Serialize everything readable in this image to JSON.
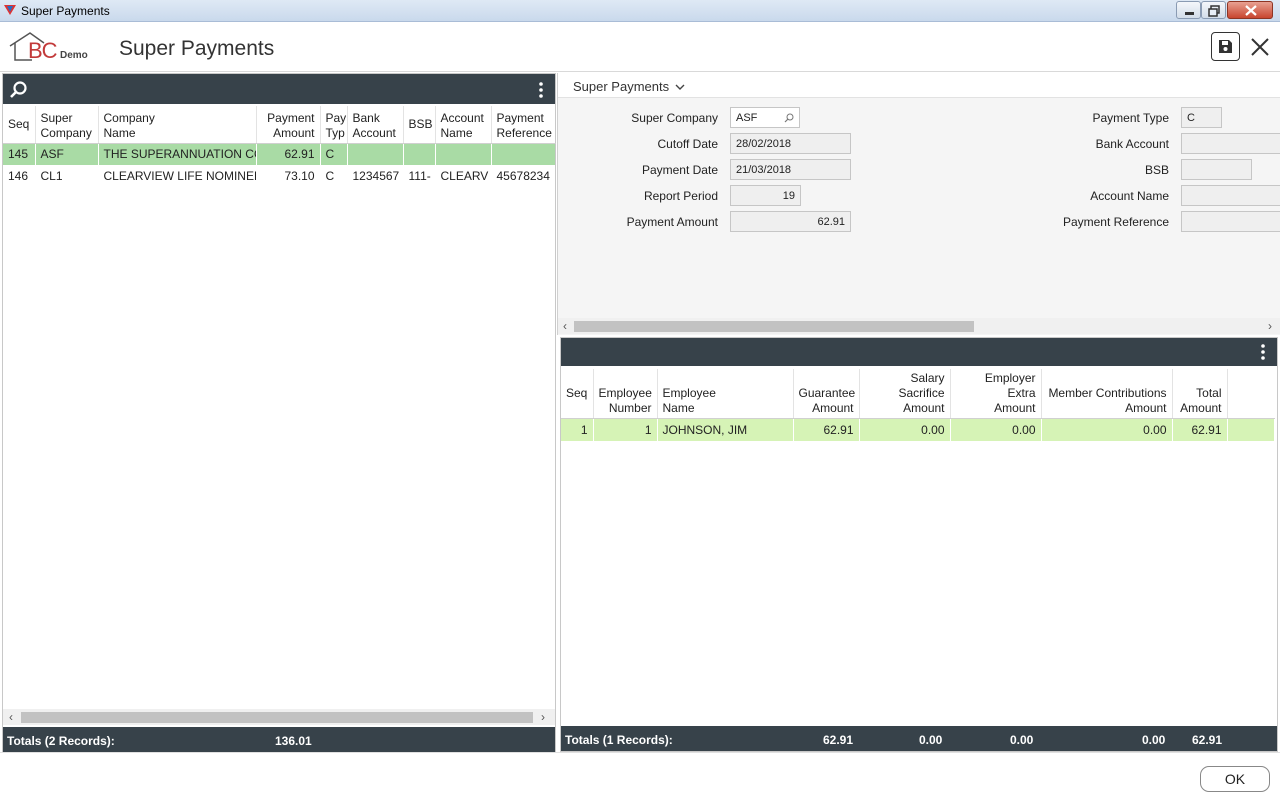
{
  "window": {
    "title": "Super Payments"
  },
  "header": {
    "logo_text": "BC",
    "logo_sub": "Demo",
    "title": "Super Payments"
  },
  "left_grid": {
    "columns": [
      "Seq",
      "Super Company",
      "Company Name",
      "Payment Amount",
      "Pay Typ",
      "Bank Account",
      "BSB",
      "Account Name",
      "Payment Reference"
    ],
    "columns_wrapped": [
      [
        "Seq"
      ],
      [
        "Super",
        "Company"
      ],
      [
        "Company",
        "Name"
      ],
      [
        "Payment",
        "Amount"
      ],
      [
        "Pay",
        "Typ"
      ],
      [
        "Bank",
        "Account"
      ],
      [
        "BSB"
      ],
      [
        "Account",
        "Name"
      ],
      [
        "Payment",
        "Reference"
      ]
    ],
    "rows": [
      {
        "seq": "145",
        "super_company": "ASF",
        "company_name": "THE SUPERANNUATION CO",
        "payment_amount": "62.91",
        "pay_typ": "C",
        "bank_account": "",
        "bsb": "",
        "account_name": "",
        "payment_reference": ""
      },
      {
        "seq": "146",
        "super_company": "CL1",
        "company_name": "CLEARVIEW LIFE NOMINEES",
        "payment_amount": "73.10",
        "pay_typ": "C",
        "bank_account": "1234567",
        "bsb": "111-",
        "account_name": "CLEARV",
        "payment_reference": "45678234"
      }
    ],
    "totals_label": "Totals (2 Records):",
    "totals_amount": "136.01"
  },
  "form": {
    "section_label": "Super Payments",
    "super_company_label": "Super Company",
    "super_company_value": "ASF",
    "cutoff_date_label": "Cutoff Date",
    "cutoff_date_value": "28/02/2018",
    "payment_date_label": "Payment Date",
    "payment_date_value": "21/03/2018",
    "report_period_label": "Report Period",
    "report_period_value": "19",
    "payment_amount_label": "Payment Amount",
    "payment_amount_value": "62.91",
    "payment_type_label": "Payment Type",
    "payment_type_value": "C",
    "bank_account_label": "Bank Account",
    "bank_account_value": "",
    "bsb_label": "BSB",
    "bsb_value": "",
    "account_name_label": "Account Name",
    "account_name_value": "",
    "payment_reference_label": "Payment Reference",
    "payment_reference_value": ""
  },
  "right_grid": {
    "columns_wrapped": [
      [
        "Seq"
      ],
      [
        "Employee",
        "Number"
      ],
      [
        "Employee",
        "Name"
      ],
      [
        "Guarantee",
        "Amount"
      ],
      [
        "Salary Sacrifice",
        "Amount"
      ],
      [
        "Employer Extra",
        "Amount"
      ],
      [
        "Member Contributions",
        "Amount"
      ],
      [
        "Total",
        "Amount"
      ]
    ],
    "rows": [
      {
        "seq": "1",
        "employee_number": "1",
        "employee_name": "JOHNSON, JIM",
        "guarantee_amount": "62.91",
        "salary_sacrifice_amount": "0.00",
        "employer_extra_amount": "0.00",
        "member_contributions_amount": "0.00",
        "total_amount": "62.91"
      }
    ],
    "totals_label": "Totals (1 Records):",
    "totals": {
      "guarantee": "62.91",
      "salary_sacrifice": "0.00",
      "employer_extra": "0.00",
      "member_contributions": "0.00",
      "total": "62.91"
    }
  },
  "footer": {
    "ok_label": "OK"
  },
  "colors": {
    "dark_bar": "#37424a",
    "selected_row_left": "#a9dba5",
    "selected_row_right": "#d6f3b6",
    "logo_red": "#c23a3a"
  },
  "icons": [
    "app-icon",
    "minimize-icon",
    "maximize-icon",
    "close-icon",
    "save-icon",
    "close-x-icon",
    "search-icon",
    "more-vert-icon",
    "lookup-icon",
    "chevron-down-icon"
  ]
}
